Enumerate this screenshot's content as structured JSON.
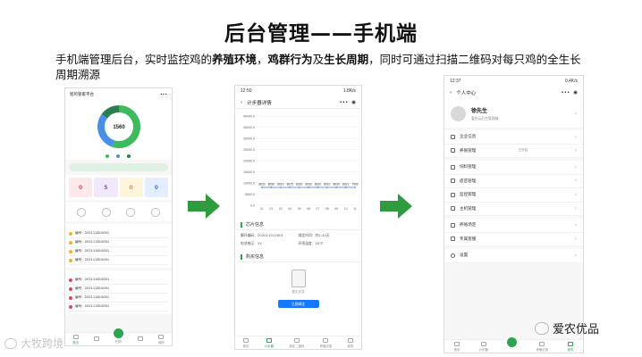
{
  "slide": {
    "title": "后台管理——手机端",
    "intro": {
      "part1": "手机端管理后台，实时监控鸡的",
      "bold1": "养殖环境",
      "sep1": "，",
      "bold2": "鸡群行为",
      "sep2": "及",
      "bold3": "生长周期",
      "part2": "，同时可通过扫描二维码对每只鸡的全生长周期溯源"
    }
  },
  "colors": {
    "accent_green": "#2ea44f",
    "arrow_green": "#2e9b3f",
    "button_blue": "#1677ff",
    "donut_blue": "#4a8fe7",
    "donut_green": "#3dbb5c",
    "donut_dark": "#2a7d4f"
  },
  "phone1": {
    "time": "",
    "title": "智鸡管家平台",
    "donut_center": "1560",
    "donut_segments": [
      {
        "name": "",
        "value": 55,
        "color": "#3dbb5c"
      },
      {
        "name": "",
        "value": 30,
        "color": "#4a8fe7"
      },
      {
        "name": "",
        "value": 15,
        "color": "#2a7d4f"
      }
    ],
    "legend": [
      "",
      "",
      ""
    ],
    "banner": "",
    "stats": [
      {
        "value": "0",
        "label": "",
        "bg": "#fde9ec",
        "color": "#e0485d"
      },
      {
        "value": "5",
        "label": "",
        "bg": "#f1e8fb",
        "color": "#8e54c9"
      },
      {
        "value": "0",
        "label": "",
        "bg": "#fff4dc",
        "color": "#e09a15"
      },
      {
        "value": "0",
        "label": "",
        "bg": "#e3efff",
        "color": "#2f7fe0"
      }
    ],
    "ops_title": "",
    "ops": [
      "",
      "",
      "",
      ""
    ],
    "list1_title": "",
    "list1_more": "",
    "list1": [
      {
        "text": "编号：202111810001",
        "badge": "",
        "dot": "#f0b429"
      },
      {
        "text": "编号：202111810001",
        "badge": "",
        "dot": "#f0b429"
      },
      {
        "text": "编号：202111810001",
        "badge": "",
        "dot": "#f0b429"
      },
      {
        "text": "编号：202111810001",
        "badge": "",
        "dot": "#f0b429"
      }
    ],
    "list2_title": "",
    "list2_more": "",
    "list2": [
      {
        "text": "编号：202111810001",
        "dot": "#e0485d"
      },
      {
        "text": "编号：202111810001",
        "dot": "#e0485d"
      },
      {
        "text": "编号：202111810001",
        "dot": "#e0485d"
      },
      {
        "text": "编号：202111810001",
        "dot": "#e0485d"
      }
    ],
    "tabs": [
      "首页",
      "",
      "扫码",
      "",
      "我的"
    ]
  },
  "phone2": {
    "time": "12:50",
    "status_right": "1.8K/s",
    "title": "计步器详情",
    "section_info": "芯片信息",
    "info": [
      "脚环编码：202011013001",
      "绑定时间：约2-45天",
      "电池电压：2V",
      "环境温度：20℃"
    ],
    "section_records": "购买信息",
    "empty_text": "暂无记录",
    "button": "立即绑定",
    "tabs": [
      "首页",
      "计步器",
      "绑定二维码",
      "养殖记录",
      "我的"
    ]
  },
  "chart_data": {
    "type": "line",
    "x": [
      "01",
      "01",
      "03",
      "04",
      "05",
      "06",
      "07",
      "08",
      "09",
      "10",
      "11"
    ],
    "series": [
      {
        "values": [
          8020,
          8030,
          8010,
          8025,
          8015,
          8030,
          8020,
          8010,
          8030,
          8021,
          7990
        ]
      }
    ],
    "data_labels": [
      "8020",
      "8030",
      "8010",
      "8025",
      "8015",
      "8030",
      "8020",
      "8010",
      "8030",
      "8021",
      "7990"
    ],
    "yticks": [
      "40000.0",
      "35000.0",
      "30000.0",
      "25000.0",
      "20000.0",
      "15000.0",
      "10000.0",
      "5000.0",
      "0.0"
    ],
    "ylim": [
      0,
      40000
    ],
    "grid": true
  },
  "phone3": {
    "time": "12:37",
    "status_right": "0.4K/s",
    "title": "个人中心",
    "user_name": "徐先生",
    "user_desc": "爱农云后台管理端",
    "menu": [
      {
        "label": "企业信息",
        "extra": ""
      },
      {
        "label": "养殖管理",
        "extra": "已开启"
      },
      {
        "label": "饲料管理",
        "extra": ""
      },
      {
        "label": "疫苗管理",
        "extra": ""
      },
      {
        "label": "监控管理",
        "extra": ""
      },
      {
        "label": "主机管理",
        "extra": ""
      },
      {
        "label": "养殖场定",
        "extra": ""
      },
      {
        "label": "专属客服",
        "extra": ""
      },
      {
        "label": "设置",
        "extra": ""
      }
    ],
    "tabs": [
      "首页",
      "计步器",
      "",
      "养殖记录",
      "我的"
    ]
  },
  "watermarks": {
    "left": "大牧跨境",
    "right": "爱农优品"
  }
}
